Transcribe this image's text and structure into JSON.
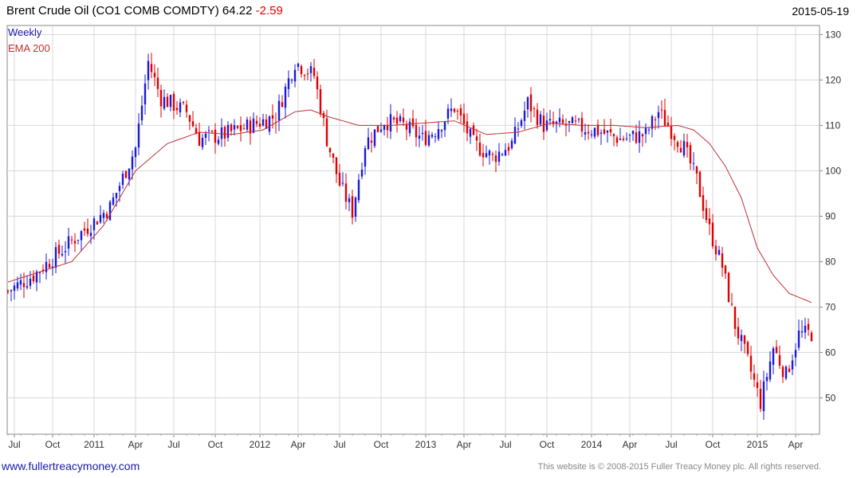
{
  "header": {
    "title": "Brent Crude Oil  (CO1 COMB COMDTY)",
    "last_price": "64.22",
    "change": "-2.59",
    "date": "2015-05-19"
  },
  "legend": {
    "weekly": "Weekly",
    "ema": "EMA 200"
  },
  "footer": {
    "url": "www.fullertreacymoney.com",
    "copyright": "This website is © 2008-2015 Fuller Treacy Money plc. All rights reserved."
  },
  "colors": {
    "up": "#1a1ad8",
    "down": "#e00000",
    "ema": "#c03030",
    "grid": "#d8d8d8",
    "frame": "#888888"
  },
  "chart_data": {
    "type": "candlestick",
    "title": "Brent Crude Oil  (CO1 COMB COMDTY) 64.22 -2.59",
    "ylim": [
      42,
      132
    ],
    "yticks": [
      50,
      60,
      70,
      80,
      90,
      100,
      110,
      120,
      130
    ],
    "ytick_labels": [
      "50",
      "60",
      "70",
      "80",
      "90",
      "100",
      "110",
      "120",
      "130"
    ],
    "xticks": [
      {
        "label": "Jul",
        "week": 2
      },
      {
        "label": "Oct",
        "week": 14
      },
      {
        "label": "2011",
        "week": 27
      },
      {
        "label": "Apr",
        "week": 40
      },
      {
        "label": "Jul",
        "week": 52
      },
      {
        "label": "Oct",
        "week": 65
      },
      {
        "label": "2012",
        "week": 79
      },
      {
        "label": "Apr",
        "week": 91
      },
      {
        "label": "Jul",
        "week": 104
      },
      {
        "label": "Oct",
        "week": 117
      },
      {
        "label": "2013",
        "week": 131
      },
      {
        "label": "Apr",
        "week": 143
      },
      {
        "label": "Jul",
        "week": 156
      },
      {
        "label": "Oct",
        "week": 169
      },
      {
        "label": "2014",
        "week": 183
      },
      {
        "label": "Apr",
        "week": 195
      },
      {
        "label": "Jul",
        "week": 208
      },
      {
        "label": "Oct",
        "week": 221
      },
      {
        "label": "2015",
        "week": 235
      },
      {
        "label": "Apr",
        "week": 247
      }
    ],
    "week_count": 253,
    "series": [
      {
        "name": "Weekly",
        "kind": "close",
        "weeks": [
          0,
          8,
          16,
          24,
          32,
          40,
          44,
          48,
          56,
          60,
          68,
          76,
          84,
          90,
          96,
          100,
          104,
          108,
          112,
          118,
          124,
          130,
          134,
          140,
          146,
          152,
          158,
          163,
          168,
          176,
          184,
          192,
          200,
          204,
          208,
          212,
          216,
          220,
          224,
          228,
          232,
          236,
          240,
          244,
          248,
          252
        ],
        "values": [
          73.5,
          77,
          82,
          87,
          92,
          105,
          124,
          116,
          113,
          107,
          108,
          110,
          112,
          124,
          121,
          107,
          97,
          91,
          106,
          111,
          110,
          107,
          109,
          114,
          106,
          103,
          106,
          115,
          110,
          110,
          109,
          107,
          108,
          113,
          109,
          105,
          98,
          87,
          79,
          66,
          58,
          49,
          61,
          55,
          64,
          64.2
        ]
      },
      {
        "name": "EMA 200",
        "kind": "ema",
        "weeks": [
          0,
          20,
          30,
          40,
          50,
          60,
          70,
          80,
          90,
          95,
          100,
          110,
          120,
          130,
          140,
          150,
          160,
          170,
          180,
          190,
          200,
          210,
          215,
          220,
          225,
          230,
          235,
          240,
          245,
          252
        ],
        "values": [
          75.5,
          80,
          88,
          100,
          106,
          108.5,
          108,
          109,
          113,
          113.4,
          112,
          110,
          110,
          110.5,
          111,
          108,
          108.5,
          110.5,
          110,
          110,
          109.5,
          110,
          109,
          106,
          101,
          94,
          83,
          77,
          73,
          71
        ]
      }
    ]
  }
}
